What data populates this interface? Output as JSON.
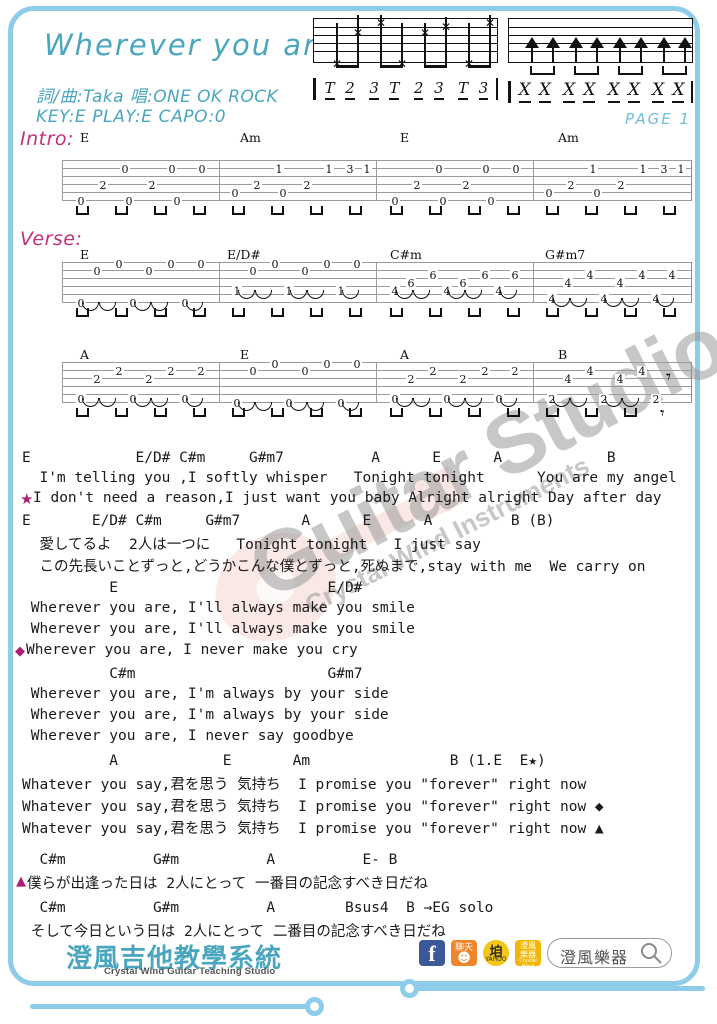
{
  "header": {
    "title": "Wherever you are",
    "credit": "詞/曲:Taka 唱:ONE OK ROCK",
    "key_line": "KEY:E  PLAY:E  CAPO:0",
    "page_mark": "PAGE 1"
  },
  "rhythm_boxes": [
    {
      "name": "fingerpicking-pattern",
      "counts": [
        "T",
        "2",
        "3",
        "T",
        "2",
        "3",
        "T",
        "3"
      ]
    },
    {
      "name": "strumming-pattern",
      "counts": [
        "X",
        "X",
        "X",
        "X",
        "X",
        "X",
        "X",
        "X"
      ]
    }
  ],
  "sections": {
    "intro_label": "Intro:",
    "verse_label": "Verse:"
  },
  "tabs": [
    {
      "name": "intro-staff",
      "chords": [
        "E",
        "Am",
        "E",
        "Am"
      ],
      "measures": [
        {
          "chord": "E",
          "notes": [
            [
              6,
              "0"
            ],
            [
              4,
              "2"
            ],
            [
              6,
              "0"
            ],
            [
              4,
              "2"
            ],
            [
              6,
              "0"
            ],
            [
              2,
              "0"
            ],
            [
              2,
              "0"
            ],
            [
              2,
              "0"
            ]
          ]
        },
        {
          "chord": "Am",
          "notes": [
            [
              5,
              "0"
            ],
            [
              4,
              "2"
            ],
            [
              5,
              "0"
            ],
            [
              4,
              "2"
            ],
            [
              2,
              "1"
            ],
            [
              2,
              "1"
            ],
            [
              2,
              "3"
            ],
            [
              2,
              "1"
            ]
          ]
        },
        {
          "chord": "E",
          "notes": [
            [
              6,
              "0"
            ],
            [
              4,
              "2"
            ],
            [
              6,
              "0"
            ],
            [
              4,
              "2"
            ],
            [
              6,
              "0"
            ],
            [
              2,
              "0"
            ],
            [
              2,
              "0"
            ],
            [
              2,
              "0"
            ]
          ]
        },
        {
          "chord": "Am",
          "notes": [
            [
              5,
              "0"
            ],
            [
              4,
              "2"
            ],
            [
              5,
              "0"
            ],
            [
              4,
              "2"
            ],
            [
              2,
              "1"
            ],
            [
              2,
              "1"
            ],
            [
              2,
              "3"
            ],
            [
              2,
              "1"
            ]
          ]
        }
      ]
    },
    {
      "name": "verse-staff-1",
      "chords": [
        "E",
        "E/D#",
        "C#m",
        "G#m7"
      ]
    },
    {
      "name": "verse-staff-2",
      "chords": [
        "A",
        "E",
        "A",
        "B"
      ]
    }
  ],
  "lyrics": [
    {
      "type": "chord",
      "text": "E            E/D# C#m     G#m7          A      E      A            B"
    },
    {
      "type": "lyric",
      "text": "  I'm telling you ,I softly whisper   Tonight tonight      You are my angel"
    },
    {
      "type": "lyric",
      "marker": "star",
      "text": "I don't need a reason,I just want you baby Alright alright Day after day"
    },
    {
      "type": "chord",
      "text": "E       E/D# C#m     G#m7       A      E      A         B (B)"
    },
    {
      "type": "lyric",
      "text": "  愛してるよ  2人は一つに   Tonight tonight   I just say"
    },
    {
      "type": "lyric",
      "text": "  この先長いことずっと,どうかこんな僕とずっと,死ぬまで,stay with me  We carry on"
    },
    {
      "type": "chord",
      "text": "          E                        E/D#"
    },
    {
      "type": "lyric",
      "text": " Wherever you are, I'll always make you smile"
    },
    {
      "type": "lyric",
      "text": " Wherever you are, I'll always make you smile"
    },
    {
      "type": "lyric",
      "marker": "diamond",
      "text": "Wherever you are, I never make you cry"
    },
    {
      "type": "chord",
      "text": "          C#m                      G#m7"
    },
    {
      "type": "lyric",
      "text": " Wherever you are, I'm always by your side"
    },
    {
      "type": "lyric",
      "text": " Wherever you are, I'm always by your side"
    },
    {
      "type": "lyric",
      "text": " Wherever you are, I never say goodbye"
    },
    {
      "type": "chord",
      "text": "          A            E       Am                B (1.E  E★)"
    },
    {
      "type": "lyric",
      "text": "Whatever you say,君を思う 気持ち  I promise you \"forever\" right now"
    },
    {
      "type": "lyric",
      "text": "Whatever you say,君を思う 気持ち  I promise you \"forever\" right now ◆"
    },
    {
      "type": "lyric",
      "text": "Whatever you say,君を思う 気持ち  I promise you \"forever\" right now ▲"
    },
    {
      "type": "chord",
      "text": "  C#m          G#m          A          E- B"
    },
    {
      "type": "lyric",
      "marker": "triangle",
      "text": "僕らが出逢った日は 2人にとって 一番目の記念すべき日だね"
    },
    {
      "type": "chord",
      "text": "  C#m          G#m          A        Bsus4  B →EG solo"
    },
    {
      "type": "lyric",
      "text": " そして今日という日は 2人にとって 二番目の記念すべき日だね"
    }
  ],
  "footer": {
    "logo_cn": "澄風吉他教學系統",
    "logo_en": "Crystal Wind Guitar Teaching Studio",
    "icons": [
      "facebook-icon",
      "pixnet-icon",
      "yahoo-icon",
      "shop-icon"
    ],
    "search_text": "澄風樂器"
  },
  "watermark": {
    "main": "Guitar Studio",
    "sub": "Crystal Wind Instruments"
  },
  "colors": {
    "frame": "#8dcdea",
    "title": "#4aa6bf",
    "section": "#c0317a",
    "marker": "#b01e71",
    "solo": "#d9399a"
  }
}
